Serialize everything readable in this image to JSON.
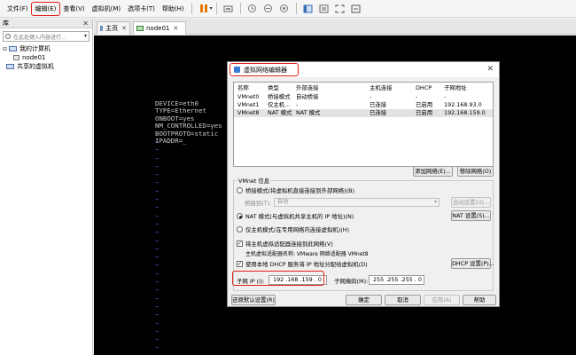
{
  "menubar": {
    "items": [
      "文件(F)",
      "编辑(E)",
      "查看(V)",
      "虚拟机(M)",
      "选项卡(T)",
      "帮助(H)"
    ],
    "toolbar_icons": [
      "pause-icon",
      "send-keys-icon",
      "snapshot-icon",
      "snapshot-revert-icon",
      "snapshot-manager-icon",
      "console-view-icon",
      "unity-icon",
      "fullscreen-icon",
      "stretch-icon"
    ]
  },
  "library": {
    "title": "库",
    "search_placeholder": "在此处键入内容进行...",
    "tree": [
      {
        "label": "我的计算机",
        "level": 0
      },
      {
        "label": "node01",
        "level": 1
      },
      {
        "label": "共享的虚拟机",
        "level": 0
      }
    ]
  },
  "tabs": [
    {
      "label": "主页",
      "icon": "home-icon"
    },
    {
      "label": "node01",
      "icon": "vm-icon",
      "active": true
    }
  ],
  "terminal": {
    "lines": [
      "DEVICE=eth0",
      "TYPE=Ethernet",
      "ONBOOT=yes",
      "NM_CONTROLLED=yes",
      "BOOTPROTO=static",
      "IPADDR=_"
    ],
    "tilde_count": 27
  },
  "dialog": {
    "title": "虚拟网络编辑器",
    "columns": [
      "名称",
      "类型",
      "外部连接",
      "主机连接",
      "DHCP",
      "子网地址"
    ],
    "rows": [
      [
        "VMnet0",
        "桥接模式",
        "自动桥接",
        "-",
        "-",
        "-"
      ],
      [
        "VMnet1",
        "仅主机...",
        "-",
        "已连接",
        "已启用",
        "192.168.93.0"
      ],
      [
        "VMnet8",
        "NAT 模式",
        "NAT 模式",
        "已连接",
        "已启用",
        "192.168.159.0"
      ]
    ],
    "selected_row": 2,
    "add_network": "添加网络(E)...",
    "remove_network": "移除网络(O)",
    "group_label": "VMnet 信息",
    "bridge_option": "桥接模式(将虚拟机直接连接到外部网络)(B)",
    "bridged_to_label": "桥接到(T):",
    "bridged_to_value": "自动",
    "auto_settings": "自动设置(U)...",
    "nat_option": "NAT 模式(与虚拟机共享主机的 IP 地址)(N)",
    "nat_settings": "NAT 设置(S)...",
    "hostonly_option": "仅主机模式(在专用网络内连接虚拟机)(H)",
    "connect_adapter": "将主机虚拟适配器连接到此网络(V)",
    "adapter_name": "主机虚拟适配器名称: VMware 网络适配器 VMnet8",
    "use_dhcp": "使用本地 DHCP 服务将 IP 地址分配给虚拟机(D)",
    "dhcp_settings": "DHCP 设置(P)...",
    "subnet_ip_label": "子网 IP (I):",
    "subnet_ip": "192 .168 .159 . 0",
    "subnet_mask_label": "子网掩码(M):",
    "subnet_mask": "255 .255 .255 . 0",
    "restore_defaults": "还原默认设置(R)",
    "ok": "确定",
    "cancel": "取消",
    "apply": "应用(A)",
    "help": "帮助"
  }
}
